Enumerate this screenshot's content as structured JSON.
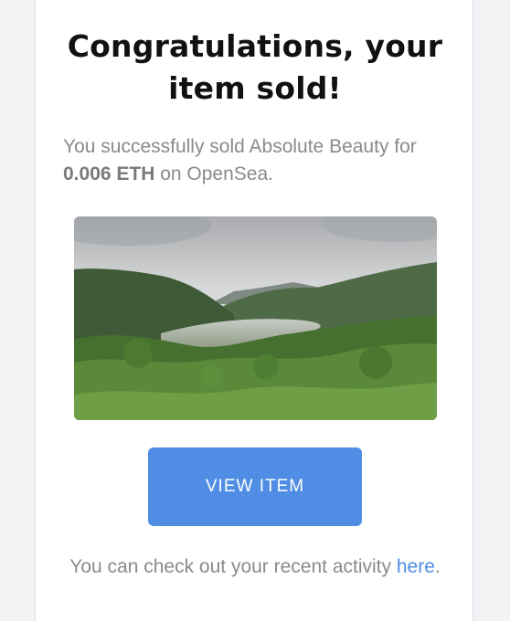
{
  "email": {
    "heading": "Congratulations, your item sold!",
    "summary_prefix": "You successfully sold Absolute Beauty for ",
    "price": "0.006 ETH",
    "summary_suffix": " on OpenSea.",
    "image_alt": "Absolute Beauty",
    "button_label": "VIEW ITEM",
    "footer_text": "You can check out your recent activity ",
    "footer_link": "here",
    "footer_end": "."
  },
  "colors": {
    "accent": "#4f8ee4",
    "muted_text": "#8a8a8a",
    "heading_text": "#111111"
  }
}
